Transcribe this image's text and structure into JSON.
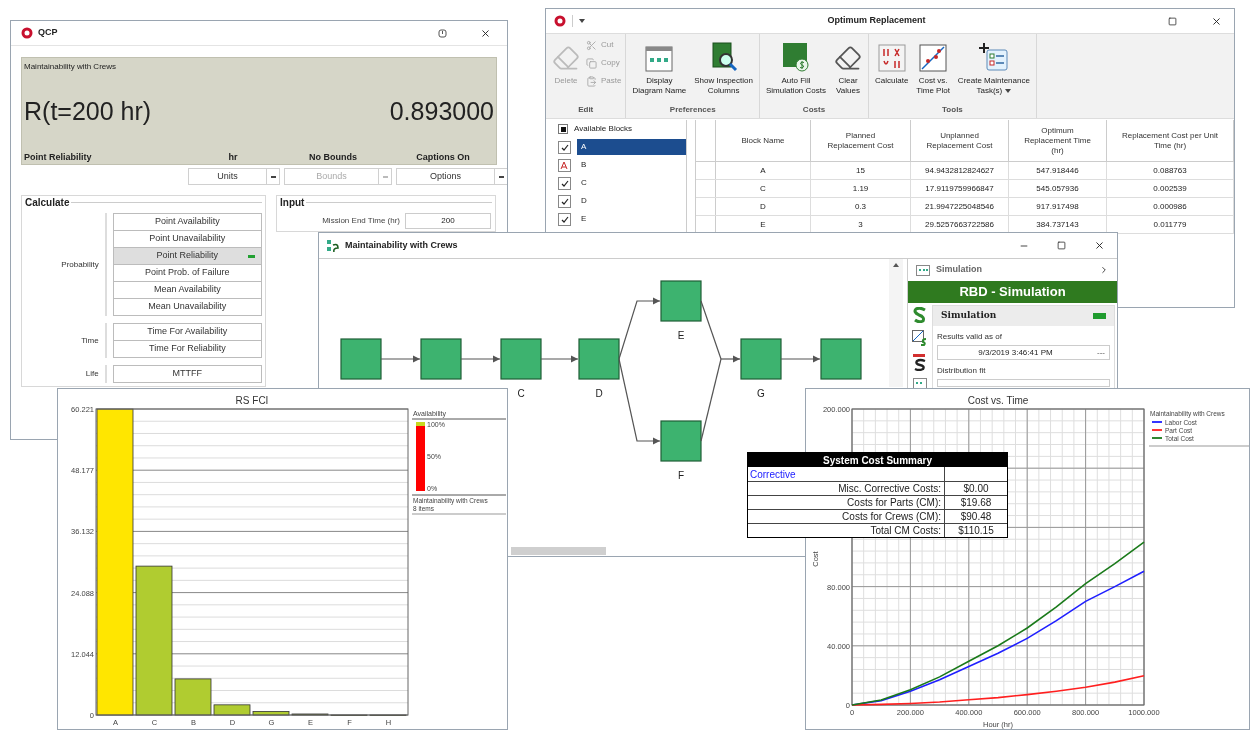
{
  "qcp": {
    "title": "QCP",
    "display": {
      "caption": "Maintainability with Crews",
      "expression": "R(t=200 hr)",
      "result": "0.893000",
      "footer": [
        "Point Reliability",
        "hr",
        "No Bounds",
        "Captions On"
      ]
    },
    "dropdowns": [
      {
        "label": "Units",
        "disabled": false
      },
      {
        "label": "Bounds",
        "disabled": true
      },
      {
        "label": "Options",
        "disabled": false
      }
    ],
    "calculate": {
      "title": "Calculate",
      "groups": [
        {
          "label": "Probability",
          "buttons": [
            {
              "label": "Point Availability",
              "selected": false
            },
            {
              "label": "Point Unavailability",
              "selected": false
            },
            {
              "label": "Point Reliability",
              "selected": true
            },
            {
              "label": "Point Prob. of Failure",
              "selected": false
            },
            {
              "label": "Mean Availability",
              "selected": false
            },
            {
              "label": "Mean Unavailability",
              "selected": false
            }
          ]
        },
        {
          "label": "Time",
          "buttons": [
            {
              "label": "Time For Availability",
              "selected": false
            },
            {
              "label": "Time For Reliability",
              "selected": false
            }
          ]
        },
        {
          "label": "Life",
          "buttons": [
            {
              "label": "MTTFF",
              "selected": false
            }
          ]
        }
      ]
    },
    "input": {
      "title": "Input",
      "fields": [
        {
          "label": "Mission End Time (hr)",
          "value": "200"
        }
      ]
    }
  },
  "optimum_replacement": {
    "title": "Optimum Replacement",
    "ribbon": [
      {
        "label": "Edit",
        "buttons": [
          {
            "lines": [
              "Delete"
            ],
            "kind": "large",
            "disabled": true
          },
          {
            "lines": [
              "Cut"
            ],
            "kind": "small",
            "disabled": true
          },
          {
            "lines": [
              "Copy"
            ],
            "kind": "small",
            "disabled": true
          },
          {
            "lines": [
              "Paste"
            ],
            "kind": "small",
            "disabled": true
          }
        ]
      },
      {
        "label": "Preferences",
        "buttons": [
          {
            "lines": [
              "Display",
              "Diagram Name"
            ],
            "kind": "large",
            "disabled": false
          },
          {
            "lines": [
              "Show Inspection",
              "Columns"
            ],
            "kind": "large",
            "disabled": false
          }
        ]
      },
      {
        "label": "Costs",
        "buttons": [
          {
            "lines": [
              "Auto Fill",
              "Simulation Costs"
            ],
            "kind": "large",
            "disabled": false
          },
          {
            "lines": [
              "Clear",
              "Values"
            ],
            "kind": "large",
            "disabled": false
          }
        ]
      },
      {
        "label": "Tools",
        "buttons": [
          {
            "lines": [
              "Calculate"
            ],
            "kind": "large",
            "disabled": false
          },
          {
            "lines": [
              "Cost vs.",
              "Time Plot"
            ],
            "kind": "large",
            "disabled": false
          },
          {
            "lines": [
              "Create Maintenance",
              "Task(s)"
            ],
            "kind": "large",
            "disabled": false,
            "menu": true
          }
        ]
      }
    ],
    "blocks_list": {
      "header": "Available Blocks",
      "header_indeterminate": true,
      "items": [
        {
          "label": "A",
          "kind": "checkbox",
          "checked": true,
          "selected": true
        },
        {
          "label": "B",
          "kind": "excluded",
          "selected": false
        },
        {
          "label": "C",
          "kind": "checkbox",
          "checked": true,
          "selected": false
        },
        {
          "label": "D",
          "kind": "checkbox",
          "checked": true,
          "selected": false
        },
        {
          "label": "E",
          "kind": "checkbox",
          "checked": true,
          "selected": false
        }
      ]
    },
    "table": {
      "columns": [
        "Block Name",
        "Planned Replacement Cost",
        "Unplanned Replacement Cost",
        "Optimum Replacement Time (hr)",
        "Replacement Cost per Unit Time (hr)"
      ],
      "rows": [
        [
          "A",
          "15",
          "94.9432812824627",
          "547.918446",
          "0.088763"
        ],
        [
          "C",
          "1.19",
          "17.9119759966847",
          "545.057936",
          "0.002539"
        ],
        [
          "D",
          "0.3",
          "21.9947225048546",
          "917.917498",
          "0.000986"
        ],
        [
          "E",
          "3",
          "29.5257663722586",
          "384.737143",
          "0.011779"
        ]
      ]
    }
  },
  "diagram_window": {
    "title": "Maintainability with Crews",
    "blocks": [
      {
        "kind": "block"
      },
      {
        "kind": "block"
      },
      {
        "kind": "block",
        "caption": "C"
      },
      {
        "kind": "block",
        "caption": "D"
      },
      {
        "kind": "block",
        "caption": "E"
      },
      {
        "kind": "block",
        "caption": "F"
      },
      {
        "kind": "block",
        "caption": "G"
      },
      {
        "kind": "block"
      }
    ],
    "panel": {
      "header": "Simulation",
      "banner": "RBD - Simulation",
      "section": {
        "title": "Simulation",
        "valid": true,
        "results_label": "Results valid as of",
        "results_value": "9/3/2019 3:46:41 PM",
        "results_button": "---",
        "fit_label": "Distribution fit"
      }
    }
  },
  "rs_fci": {
    "chart_data": {
      "type": "bar",
      "title": "RS FCI",
      "categories": [
        "A",
        "C",
        "B",
        "D",
        "G",
        "E",
        "F",
        "H"
      ],
      "stacked": true,
      "grid": true,
      "series": [
        {
          "color": "#ffe600",
          "values": [
            60.2,
            null,
            null,
            null,
            null,
            null,
            null,
            null
          ]
        },
        {
          "color": "#b0cc30",
          "values": [
            null,
            29.3,
            7.1,
            2,
            0.7,
            0.2,
            0,
            0
          ]
        }
      ],
      "ylim": [
        0,
        60.221
      ],
      "yticks": [
        0,
        12.044,
        24.088,
        36.132,
        48.177,
        60.221
      ]
    },
    "legend": {
      "title": "Availability",
      "ticks": [
        "100%",
        "50%",
        "0%"
      ],
      "caption": "Maintainability with Crews",
      "count": "8 items"
    }
  },
  "cost_vs_time": {
    "legend_title": "Maintainability with Crews",
    "chart_data": {
      "type": "line",
      "title": "Cost vs. Time",
      "xlabel": "Hour (hr)",
      "ylabel": "Cost",
      "grid": true,
      "legend": true,
      "x": [
        0,
        100,
        200,
        300,
        400,
        500,
        600,
        700,
        800,
        900,
        1000
      ],
      "series": [
        {
          "name": "Labor Cost",
          "color": "#1f1fff",
          "values": [
            0,
            3,
            9.3,
            17,
            26,
            35,
            45,
            57,
            70,
            80,
            90.4
          ]
        },
        {
          "name": "Part Cost",
          "color": "#ff1f1f",
          "values": [
            0,
            0.4,
            1,
            2,
            3.5,
            5,
            7,
            9.3,
            12,
            15.5,
            19.7
          ]
        },
        {
          "name": "Total Cost",
          "color": "#1a7a1a",
          "values": [
            0,
            3.4,
            10.3,
            19,
            29.5,
            40,
            52,
            66.3,
            82,
            95.5,
            110.1
          ]
        }
      ],
      "xlim": [
        0,
        1000
      ],
      "ylim": [
        0,
        200
      ],
      "xticks": [
        {
          "value": 0,
          "label": "0"
        },
        {
          "value": 200,
          "label": "200.000"
        },
        {
          "value": 400,
          "label": "400.000"
        },
        {
          "value": 600,
          "label": "600.000"
        },
        {
          "value": 800,
          "label": "800.000"
        },
        {
          "value": 1000,
          "label": "1000.000"
        }
      ],
      "yticks": [
        {
          "value": 0,
          "label": "0"
        },
        {
          "value": 40,
          "label": "40.000"
        },
        {
          "value": 80,
          "label": "80.000"
        },
        {
          "value": 200,
          "label": "200.000"
        }
      ]
    }
  },
  "system_cost_summary": {
    "title": "System Cost Summary",
    "section": "Corrective",
    "rows": [
      {
        "label": "Misc. Corrective Costs:",
        "value": "$0.00"
      },
      {
        "label": "Costs for Parts (CM):",
        "value": "$19.68"
      },
      {
        "label": "Costs for Crews (CM):",
        "value": "$90.48"
      },
      {
        "label": "Total CM Costs:",
        "value": "$110.15"
      }
    ]
  }
}
